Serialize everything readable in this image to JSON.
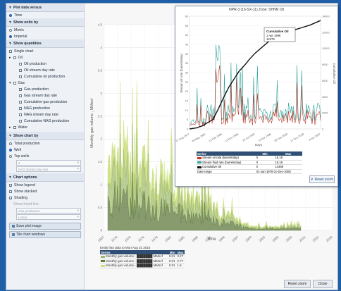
{
  "sidebar": {
    "plot_data_versus": {
      "header": "Plot data versus",
      "options": [
        {
          "label": "Time",
          "selected": true
        }
      ]
    },
    "show_units_by": {
      "header": "Show units by",
      "options": [
        {
          "label": "Metric",
          "selected": false
        },
        {
          "label": "Imperial",
          "selected": true
        }
      ]
    },
    "show_quantities": {
      "header": "Show quantities",
      "single_chart": {
        "label": "Single chart",
        "checked": false
      },
      "oil": {
        "label": "Oil",
        "children": [
          {
            "label": "Oil production",
            "checked": false
          },
          {
            "label": "Oil stream day rate",
            "checked": false
          },
          {
            "label": "Cumulative oil production",
            "checked": false
          }
        ]
      },
      "gas": {
        "label": "Gas",
        "children": [
          {
            "label": "Gas production",
            "checked": true
          },
          {
            "label": "Gas stream day rate",
            "checked": false
          },
          {
            "label": "Cumulative gas production",
            "checked": false
          },
          {
            "label": "NAG production",
            "checked": false
          },
          {
            "label": "NAG stream day rate",
            "checked": false
          },
          {
            "label": "Cumulative NAG production",
            "checked": false
          }
        ]
      },
      "water": {
        "label": "Water"
      }
    },
    "show_chart_by": {
      "header": "Show chart by",
      "options": [
        {
          "label": "Total production",
          "selected": false
        },
        {
          "label": "Well",
          "selected": true
        },
        {
          "label": "Top wells",
          "selected": false
        }
      ],
      "select1": "5",
      "select2": "NAG stream day rate"
    },
    "chart_options": {
      "header": "Chart options",
      "options": [
        {
          "label": "Show legend",
          "checked": true
        },
        {
          "label": "Show stacked",
          "checked": true
        },
        {
          "label": "Shading",
          "checked": true
        }
      ],
      "trend_label": "Show trend line",
      "trend_select1": "Gas production",
      "trend_select2": "Linear"
    },
    "save_button": "Save plot image",
    "tile_button": "Tile chart windows"
  },
  "main_chart": {
    "y_axis_label": "Monthly gas volume , MMscf",
    "x_axis_label": "Time",
    "y_ticks": [
      "4.5",
      "4",
      "3.5",
      "3",
      "2.5",
      "2",
      "1.5",
      "1",
      "0.5",
      "0"
    ],
    "x_ticks": [
      "1967",
      "1970",
      "1973",
      "1976",
      "1979",
      "1982",
      "1985",
      "1988",
      "1991",
      "1994",
      "1997",
      "2000",
      "2003",
      "2006",
      "2009",
      "2012",
      "2015",
      "2018"
    ],
    "series_colors": [
      "#9db86a",
      "#5f7a3f",
      "#c9dd7a"
    ]
  },
  "legend": {
    "header_note": "Entity has data to Mon Aug 31 2015",
    "columns": [
      "Series",
      "Min",
      "Max"
    ],
    "rows": [
      {
        "series": "Monthly gas volume - ███████ MMscf",
        "min": "0.01",
        "max": "3.27",
        "color": "#9db86a"
      },
      {
        "series": "Monthly gas volume - ███████ MMscf",
        "min": "0.01",
        "max": "2.77",
        "color": "#5f7a3f"
      },
      {
        "series": "Monthly gas volume - ███████ MMscf",
        "min": "0.01",
        "max": "1.6",
        "color": "#c9dd7a"
      }
    ]
  },
  "bottom_buttons": {
    "reset": "Reset zoom",
    "close": "Close"
  },
  "popup": {
    "title": "NPR-3 (16-SX-11) Zone: SHNN Oil",
    "left_axis_label": "Stream oil rate (barrels/day)",
    "right_axis_label": "Cumulative Oil",
    "x_axis_label": "Days",
    "left_ticks": [
      "60",
      "55",
      "50",
      "45",
      "40",
      "35",
      "30",
      "25",
      "20",
      "15",
      "10",
      "5",
      "0"
    ],
    "right_ticks": [
      "14000",
      "12000",
      "10000",
      "8000",
      "6000",
      "4000",
      "2000",
      "0"
    ],
    "x_ticks": [
      "27 Aug 1977",
      "28 May 1981",
      "11 Feb 1985",
      "12 Nov 1988",
      "20 Jul 1992",
      "15 Apr 1996",
      "28 Feb 2000",
      "17 Nov 2003",
      "4 Apr 2007"
    ],
    "tooltip": {
      "title": "Cumulative Oil",
      "date": "1 Apr 1996",
      "value": "12478"
    },
    "table_columns": [
      "Series",
      "Min",
      "Max"
    ],
    "table_rows": [
      {
        "series": "Stream oil rate (barrels/day)",
        "min": "0",
        "max": "19.18",
        "color": "#c0392b"
      },
      {
        "series": "Stream fluid rate (barrels/day)",
        "min": "0",
        "max": "19.18",
        "color": "#2aa198"
      },
      {
        "series": "Cumulative Oil",
        "min": "0",
        "max": "13469",
        "color": "#111111"
      }
    ],
    "date_range_label": "Date range",
    "date_range": "01-Jan-1978 01-Dec-2008",
    "reset_button": "Reset zoom"
  }
}
